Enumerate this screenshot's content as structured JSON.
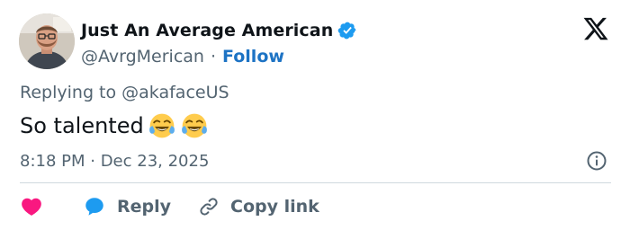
{
  "author": {
    "display_name": "Just An Average American",
    "handle": "@AvrgMerican",
    "separator": "·",
    "follow_label": "Follow",
    "verified": true
  },
  "tweet": {
    "replying_to": "Replying to @akafaceUS",
    "text": "So talented",
    "emojis": [
      "face-with-tears-of-joy",
      "face-with-tears-of-joy"
    ],
    "timestamp": "8:18 PM · Dec 23, 2025"
  },
  "actions": {
    "reply_label": "Reply",
    "copy_link_label": "Copy link"
  },
  "colors": {
    "text_primary": "#0f1419",
    "text_secondary": "#536471",
    "link_blue": "#1d73c4",
    "verified_blue": "#1d9bf0",
    "heart_pink": "#f91880",
    "divider": "#cfd9de"
  },
  "icons": {
    "brand": "x-logo-icon",
    "verified": "verified-badge-icon",
    "info": "info-icon",
    "like": "heart-icon",
    "reply": "reply-bubble-icon",
    "copy_link": "link-icon"
  }
}
